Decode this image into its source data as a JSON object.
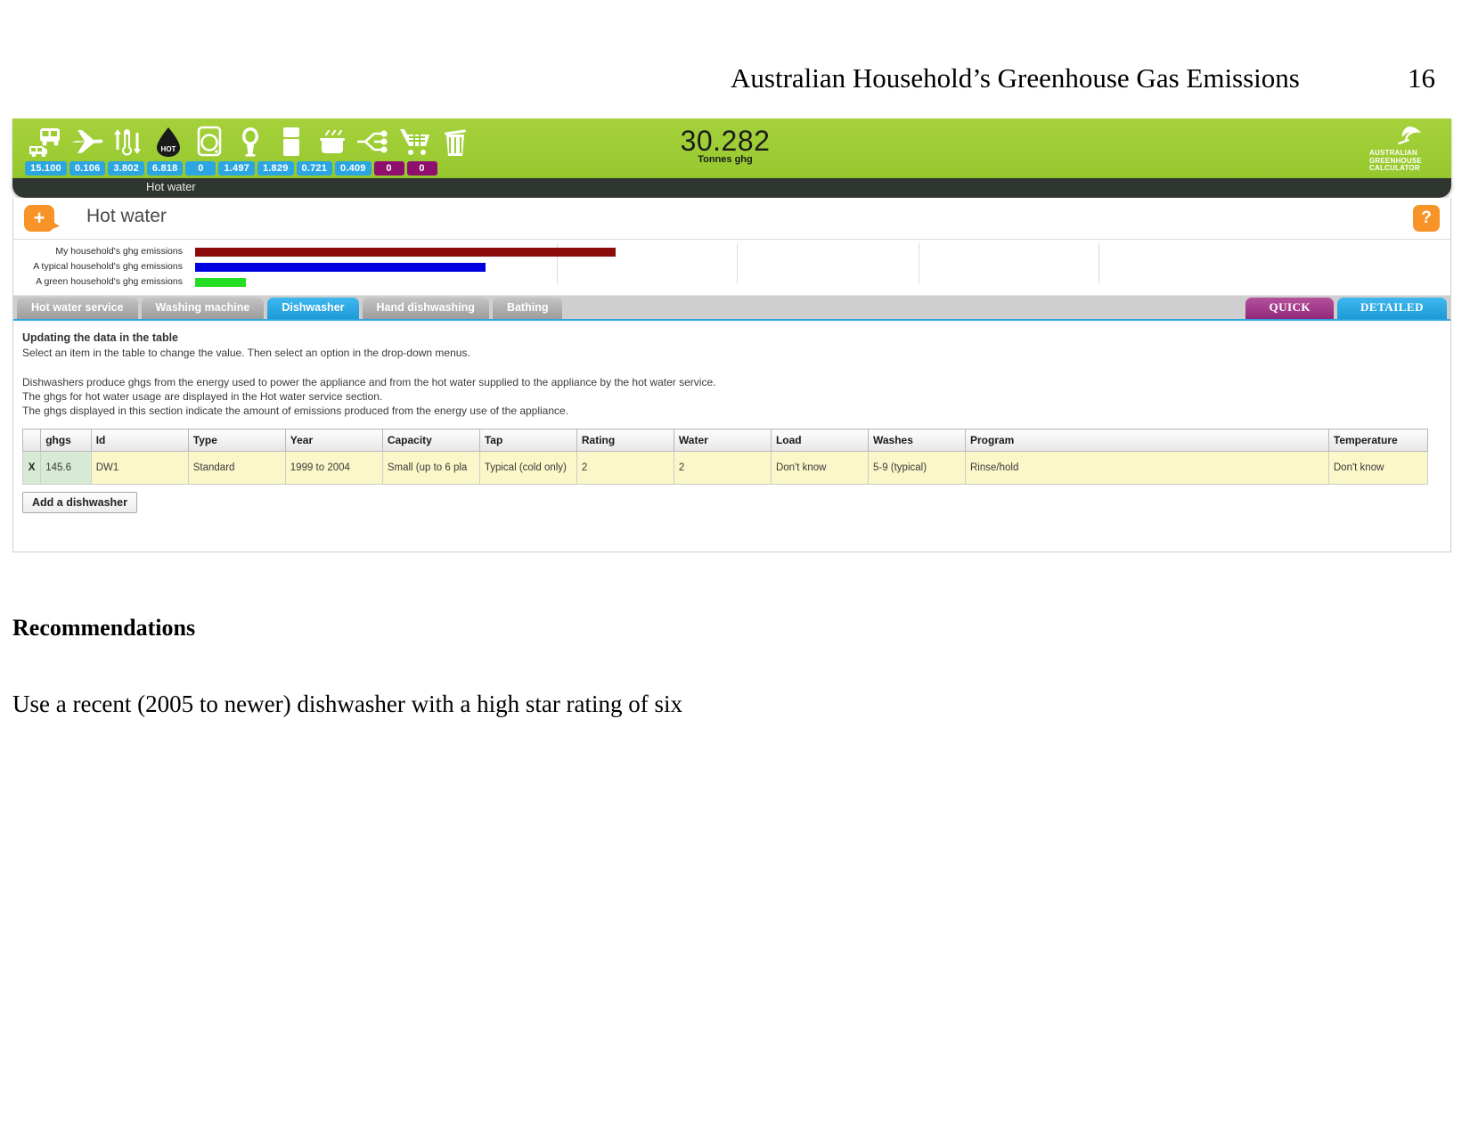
{
  "document": {
    "title": "Australian Household’s Greenhouse Gas Emissions",
    "page_number": "16"
  },
  "appbar": {
    "total_value": "30.282",
    "total_unit": "Tonnes ghg",
    "logo_line1": "AUSTRALIAN",
    "logo_line2": "GREENHOUSE",
    "logo_line3": "CALCULATOR",
    "section_label": "Hot water",
    "categories": [
      {
        "icon": "car-bus-icon",
        "value": "15.100",
        "color": "#2ba6e0"
      },
      {
        "icon": "airplane-icon",
        "value": "0.106",
        "color": "#2ba6e0"
      },
      {
        "icon": "thermometer-icon",
        "value": "3.802",
        "color": "#2ba6e0"
      },
      {
        "icon": "hot-water-drop-icon",
        "value": "6.818",
        "color": "#2ba6e0"
      },
      {
        "icon": "washing-machine-icon",
        "value": "0",
        "color": "#2ba6e0"
      },
      {
        "icon": "light-bulb-icon",
        "value": "1.497",
        "color": "#2ba6e0"
      },
      {
        "icon": "refrigerator-icon",
        "value": "1.829",
        "color": "#2ba6e0"
      },
      {
        "icon": "cooking-pot-icon",
        "value": "0.721",
        "color": "#2ba6e0"
      },
      {
        "icon": "power-plug-icon",
        "value": "0.409",
        "color": "#2ba6e0"
      },
      {
        "icon": "shopping-trolley-icon",
        "value": "0",
        "color": "#8e0f6e"
      },
      {
        "icon": "waste-bin-icon",
        "value": "0",
        "color": "#8e0f6e"
      }
    ]
  },
  "panel": {
    "title": "Hot water",
    "add_label": "+",
    "help_label": "?"
  },
  "chart_data": {
    "type": "bar",
    "title": "",
    "xlabel": "",
    "ylabel": "",
    "orientation": "horizontal",
    "grid": true,
    "xlim": [
      0,
      1340
    ],
    "categories": [
      "My household's ghg emissions",
      "A typical household's ghg emissions",
      "A green household's ghg emissions"
    ],
    "values": [
      472,
      326,
      57
    ],
    "colors": [
      "#8c0b0b",
      "#0000e0",
      "#22dd22"
    ],
    "gridlines": [
      406,
      608,
      812,
      1014
    ]
  },
  "tabs": [
    {
      "label": "Hot water service",
      "active": false
    },
    {
      "label": "Washing machine",
      "active": false
    },
    {
      "label": "Dishwasher",
      "active": true
    },
    {
      "label": "Hand dishwashing",
      "active": false
    },
    {
      "label": "Bathing",
      "active": false
    }
  ],
  "mode_buttons": [
    {
      "label": "QUICK",
      "color": "#91287c"
    },
    {
      "label": "DETAILED",
      "color": "#1d9ad8"
    }
  ],
  "instructions": {
    "heading": "Updating the data in the table",
    "line1": "Select an item in the table to change the value. Then select an option in the drop-down menus.",
    "line2": "Dishwashers produce ghgs from the energy used to power the appliance and from the hot water supplied to the appliance by the hot water service.",
    "line3": "The ghgs for hot water usage are displayed in the Hot water service section.",
    "line4": "The ghgs displayed in this section indicate the amount of emissions produced from the energy use of the appliance."
  },
  "table": {
    "columns": [
      "",
      "ghgs",
      "Id",
      "Type",
      "Year",
      "Capacity",
      "Tap",
      "Rating",
      "Water",
      "Load",
      "Washes",
      "Program",
      "",
      "Temperature"
    ],
    "rows": [
      {
        "remove": "X",
        "ghgs": "145.6",
        "id": "DW1",
        "type": "Standard",
        "year": "1999 to 2004",
        "capacity": "Small (up to 6 pla",
        "tap": "Typical (cold only)",
        "rating": "2",
        "water": "2",
        "load": "Don't know",
        "washes": "5-9 (typical)",
        "program": "Rinse/hold",
        "spare": "",
        "temperature": "Don't know"
      }
    ],
    "add_button": "Add a dishwasher"
  },
  "recommendations": {
    "heading": "Recommendations",
    "text": "Use a recent (2005 to newer) dishwasher with a high star rating of six"
  }
}
